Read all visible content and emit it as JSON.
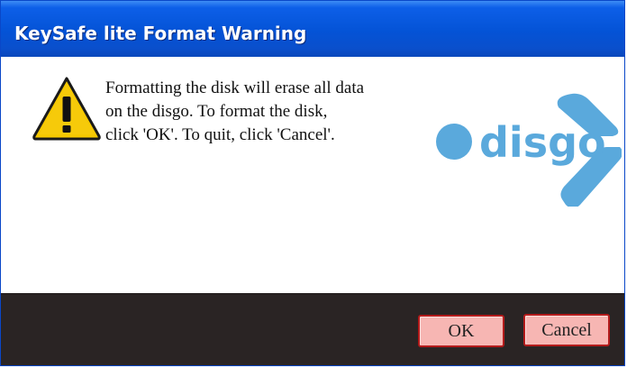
{
  "window": {
    "title": "KeySafe lite Format Warning"
  },
  "message": {
    "lines": [
      "Formatting the disk will erase all data",
      "on the disgo.  To format the disk,",
      "click 'OK'.  To quit, click 'Cancel'."
    ]
  },
  "logo": {
    "text": "disgo",
    "color": "#5aa9dc"
  },
  "buttons": {
    "ok_label": "OK",
    "cancel_label": "Cancel"
  },
  "icons": {
    "warning": "warning-icon"
  },
  "colors": {
    "titlebar": "#0453d6",
    "footer": "#2a2424",
    "button_fill": "#f7b6b3",
    "button_border": "#b31b1b",
    "warning_yellow": "#f5c800"
  }
}
